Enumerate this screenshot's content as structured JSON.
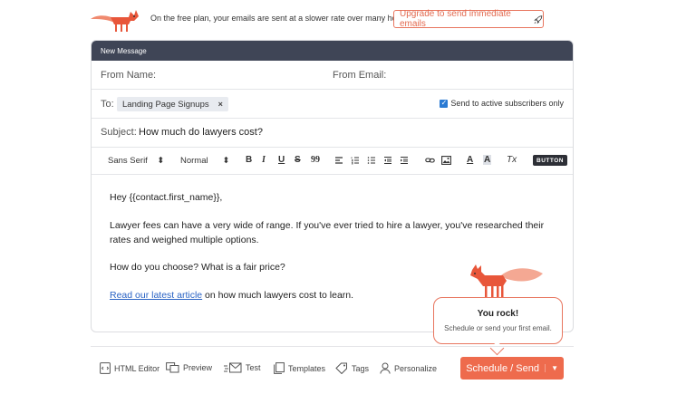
{
  "colors": {
    "accent": "#ee6b4d",
    "header_bg": "#3f4556",
    "link": "#2a63c4",
    "checkbox": "#2a7ad3"
  },
  "banner": {
    "logo_icon": "fox-logo-icon",
    "plan_text": "On the free plan, your emails are sent at a slower rate over many hours.",
    "upgrade_label": "Upgrade to send immediate emails",
    "upgrade_icon": "rocket-icon"
  },
  "composer": {
    "header_title": "New Message",
    "from_name_label": "From Name:",
    "from_email_label": "From Email:",
    "to_label": "To:",
    "to_tag": "Landing Page Signups",
    "to_tag_remove": "×",
    "active_only_label": "Send to active subscribers only",
    "active_only_checked": true,
    "subject_label": "Subject:",
    "subject_value": "How much do lawyers cost?"
  },
  "toolbar": {
    "font_family": "Sans Serif",
    "font_size": "Normal",
    "bold": "B",
    "italic": "I",
    "underline": "U",
    "strike": "S",
    "quote": "99",
    "text_color": "A",
    "bg_color": "A",
    "clear_format": "Tx",
    "button_label": "BUTTON"
  },
  "body": {
    "greeting": "Hey {{contact.first_name}},",
    "para1": "Lawyer fees can have a very wide of range. If you've ever tried to hire a lawyer, you've researched their rates and weighed multiple options.",
    "para2": "How do you choose? What is a fair price?",
    "link_text": "Read our latest article",
    "link_suffix": " on how much lawyers cost to learn."
  },
  "popover": {
    "title": "You rock!",
    "subtitle": "Schedule or send your first email."
  },
  "footer": {
    "html_editor": "HTML Editor",
    "preview": "Preview",
    "test": "Test",
    "templates": "Templates",
    "tags": "Tags",
    "personalize": "Personalize",
    "schedule_send": "Schedule / Send"
  }
}
